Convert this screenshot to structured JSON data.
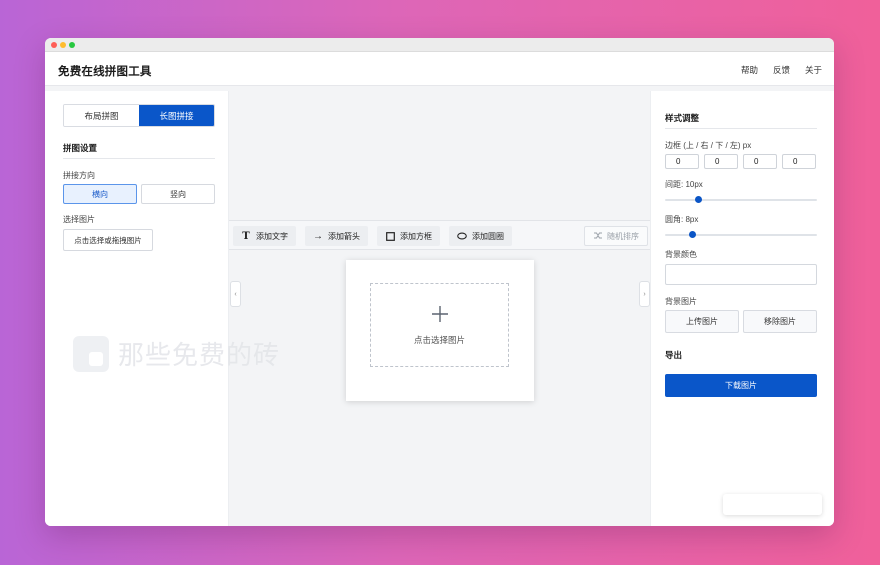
{
  "app": {
    "title": "免费在线拼图工具"
  },
  "nav": {
    "help": "帮助",
    "feedback": "反馈",
    "about": "关于"
  },
  "left": {
    "tabs": [
      "布局拼图",
      "长图拼接"
    ],
    "active_tab": 1,
    "settings_title": "拼图设置",
    "direction_label": "拼接方向",
    "direction_options": [
      "横向",
      "竖向"
    ],
    "direction_selected": 0,
    "select_image_label": "选择图片",
    "select_button": "点击选择或拖拽图片"
  },
  "toolbar": {
    "add_text": "添加文字",
    "add_arrow": "添加箭头",
    "add_box": "添加方框",
    "add_circle": "添加圆圈",
    "random_sort": "随机排序"
  },
  "canvas": {
    "drop_text": "点击选择图片"
  },
  "watermark": {
    "text": "那些免费的砖"
  },
  "right": {
    "style_title": "样式调整",
    "border_label": "边框 (上 / 右 / 下 / 左) px",
    "border_values": [
      "0",
      "0",
      "0",
      "0"
    ],
    "gap_label": "间距: 10px",
    "gap_value_fraction": 0.22,
    "radius_label": "圆角: 8px",
    "radius_value_fraction": 0.18,
    "bg_color_label": "背景颜色",
    "bg_image_label": "背景图片",
    "upload_button": "上传图片",
    "remove_button": "移除图片",
    "export_title": "导出",
    "download_button": "下载图片"
  },
  "colors": {
    "accent": "#0a56c9",
    "accent_light": "#e8f1fe"
  },
  "icons": {
    "add_text": "text-T-icon",
    "add_arrow": "arrow-right-icon",
    "add_box": "square-icon",
    "add_circle": "ellipse-icon",
    "random_sort": "shuffle-icon",
    "drop": "plus-icon",
    "collapse_left": "chevron-left-icon",
    "collapse_right": "chevron-right-icon"
  }
}
